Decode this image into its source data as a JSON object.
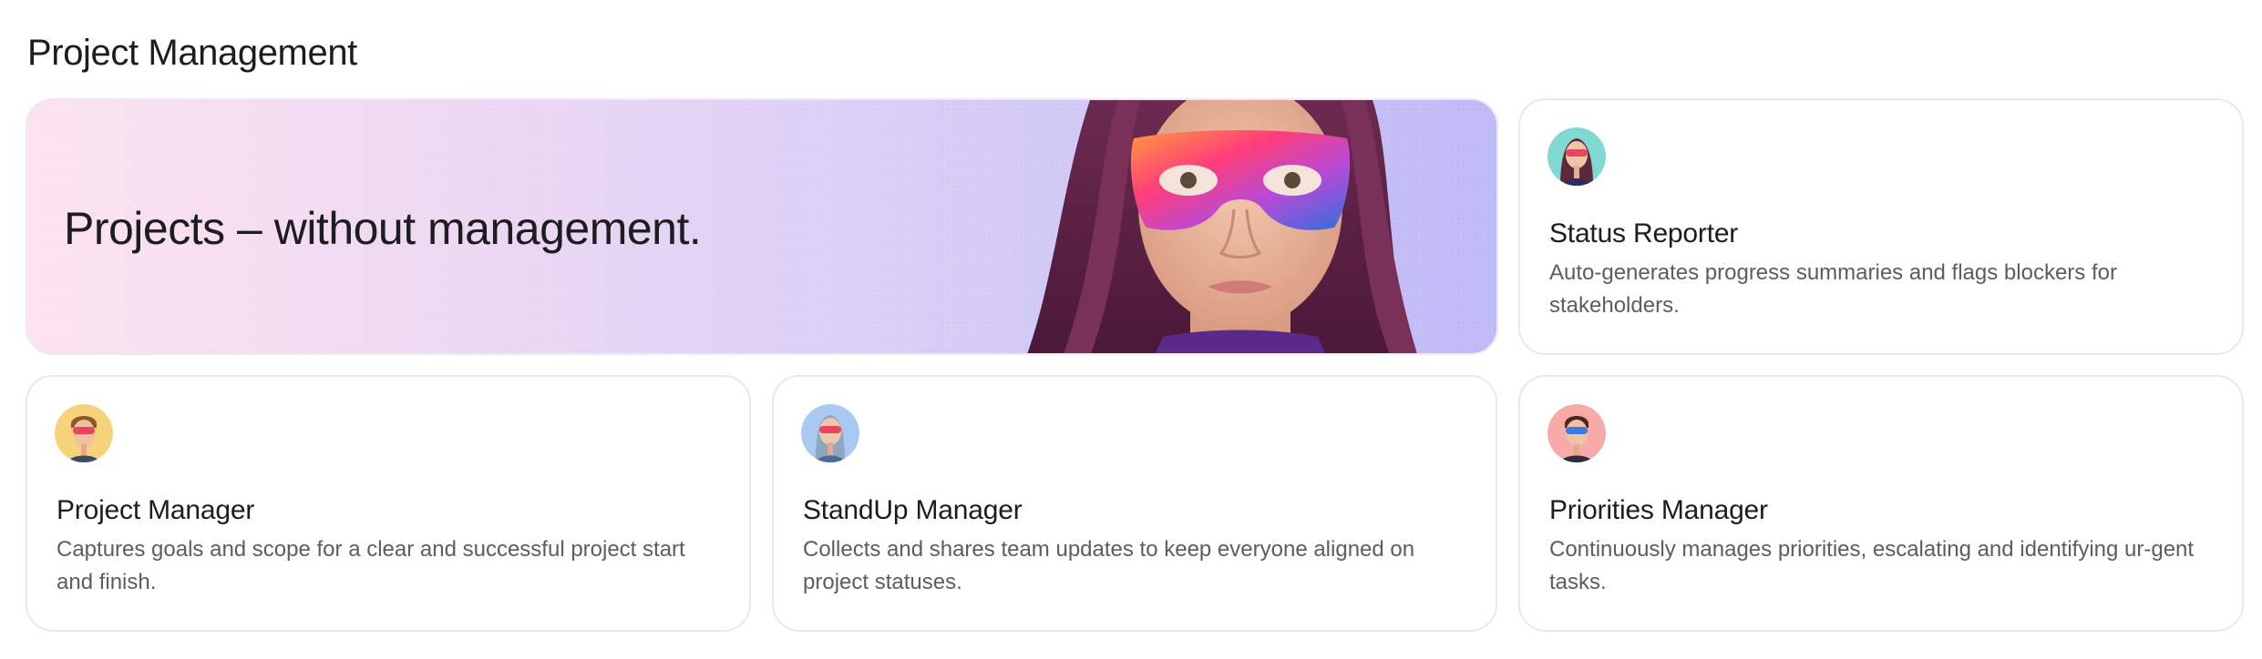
{
  "section": {
    "title": "Project Management"
  },
  "hero": {
    "title": "Projects – without management.",
    "image": "woman-with-colorful-mask-illustration"
  },
  "agents": [
    {
      "name": "Status Reporter",
      "description": "Auto-generates progress summaries and flags blockers for stakeholders.",
      "avatar_bg": "#7fd8d2"
    },
    {
      "name": "Project Manager",
      "description": "Captures goals and scope for a clear and successful project start and finish.",
      "avatar_bg": "#f6d27a"
    },
    {
      "name": "StandUp Manager",
      "description": "Collects and shares team updates to keep everyone aligned on project statuses.",
      "avatar_bg": "#a9c8f2"
    },
    {
      "name": "Priorities Manager",
      "description": "Continuously manages priorities, escalating and identifying ur-gent tasks.",
      "avatar_bg": "#f7aaa8"
    }
  ],
  "colors": {
    "hero_gradient_start": "#fde3ef",
    "hero_gradient_end": "#bfb9f7",
    "card_border": "#e9e9ec",
    "text_primary": "#1d1d1f",
    "text_secondary": "#5c5c63"
  }
}
